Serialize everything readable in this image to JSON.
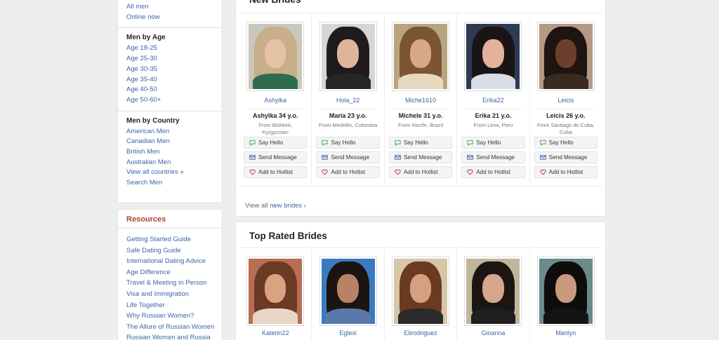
{
  "sidebar": {
    "men_links": [
      "All men",
      "Online now"
    ],
    "by_age": {
      "heading": "Men by Age",
      "items": [
        "Age 18-25",
        "Age 25-30",
        "Age 30-35",
        "Age 35-40",
        "Age 40-50",
        "Age 50-60+"
      ]
    },
    "by_country": {
      "heading": "Men by Country",
      "items": [
        "American Men",
        "Canadian Men",
        "British Men",
        "Australian Men",
        "View all countries »",
        "Search Men"
      ]
    },
    "resources": {
      "title": "Resources",
      "items": [
        "Getting Started Guide",
        "Safe Dating Guide",
        "International Dating Advice",
        "Age Difference",
        "Travel & Meeting in Person",
        "Visa and Immigration",
        "Life Together",
        "Why Russian Women?",
        "The Allure of Russian Women",
        "Russian Women and Russia"
      ]
    }
  },
  "new_brides": {
    "title": "New Brides",
    "actions": {
      "say_hello": "Say Hello",
      "send_message": "Send Message",
      "add_hotlist": "Add to Hotlist"
    },
    "view_all_prefix": "View all ",
    "view_all_link": "new brides",
    "view_all_arrow": "›",
    "cards": [
      {
        "nick": "Ashylka",
        "age": "Ashylka 34 y.o.",
        "from": "From Bishkek, Kyrgyzstan"
      },
      {
        "nick": "Hola_22",
        "age": "Maria 23 y.o.",
        "from": "From Medellin, Colombia"
      },
      {
        "nick": "Miche1610",
        "age": "Michele 31 y.o.",
        "from": "From Recife, Brazil"
      },
      {
        "nick": "Erika22",
        "age": "Erika 21 y.o.",
        "from": "From Lima, Peru"
      },
      {
        "nick": "Leicis",
        "age": "Leicis 26 y.o.",
        "from": "From Santiago de Cuba, Cuba"
      }
    ]
  },
  "top_rated": {
    "title": "Top Rated Brides",
    "cards": [
      {
        "nick": "Katerin22"
      },
      {
        "nick": "Eglexi"
      },
      {
        "nick": "Elirodriguez"
      },
      {
        "nick": "Gioanna"
      },
      {
        "nick": "Marilyn"
      }
    ]
  },
  "colors": {
    "link": "#3d64a8",
    "resources_title": "#b5402f",
    "hello_icon": "#4caf50",
    "message_icon": "#3d64a8",
    "hotlist_icon": "#c0392b"
  }
}
